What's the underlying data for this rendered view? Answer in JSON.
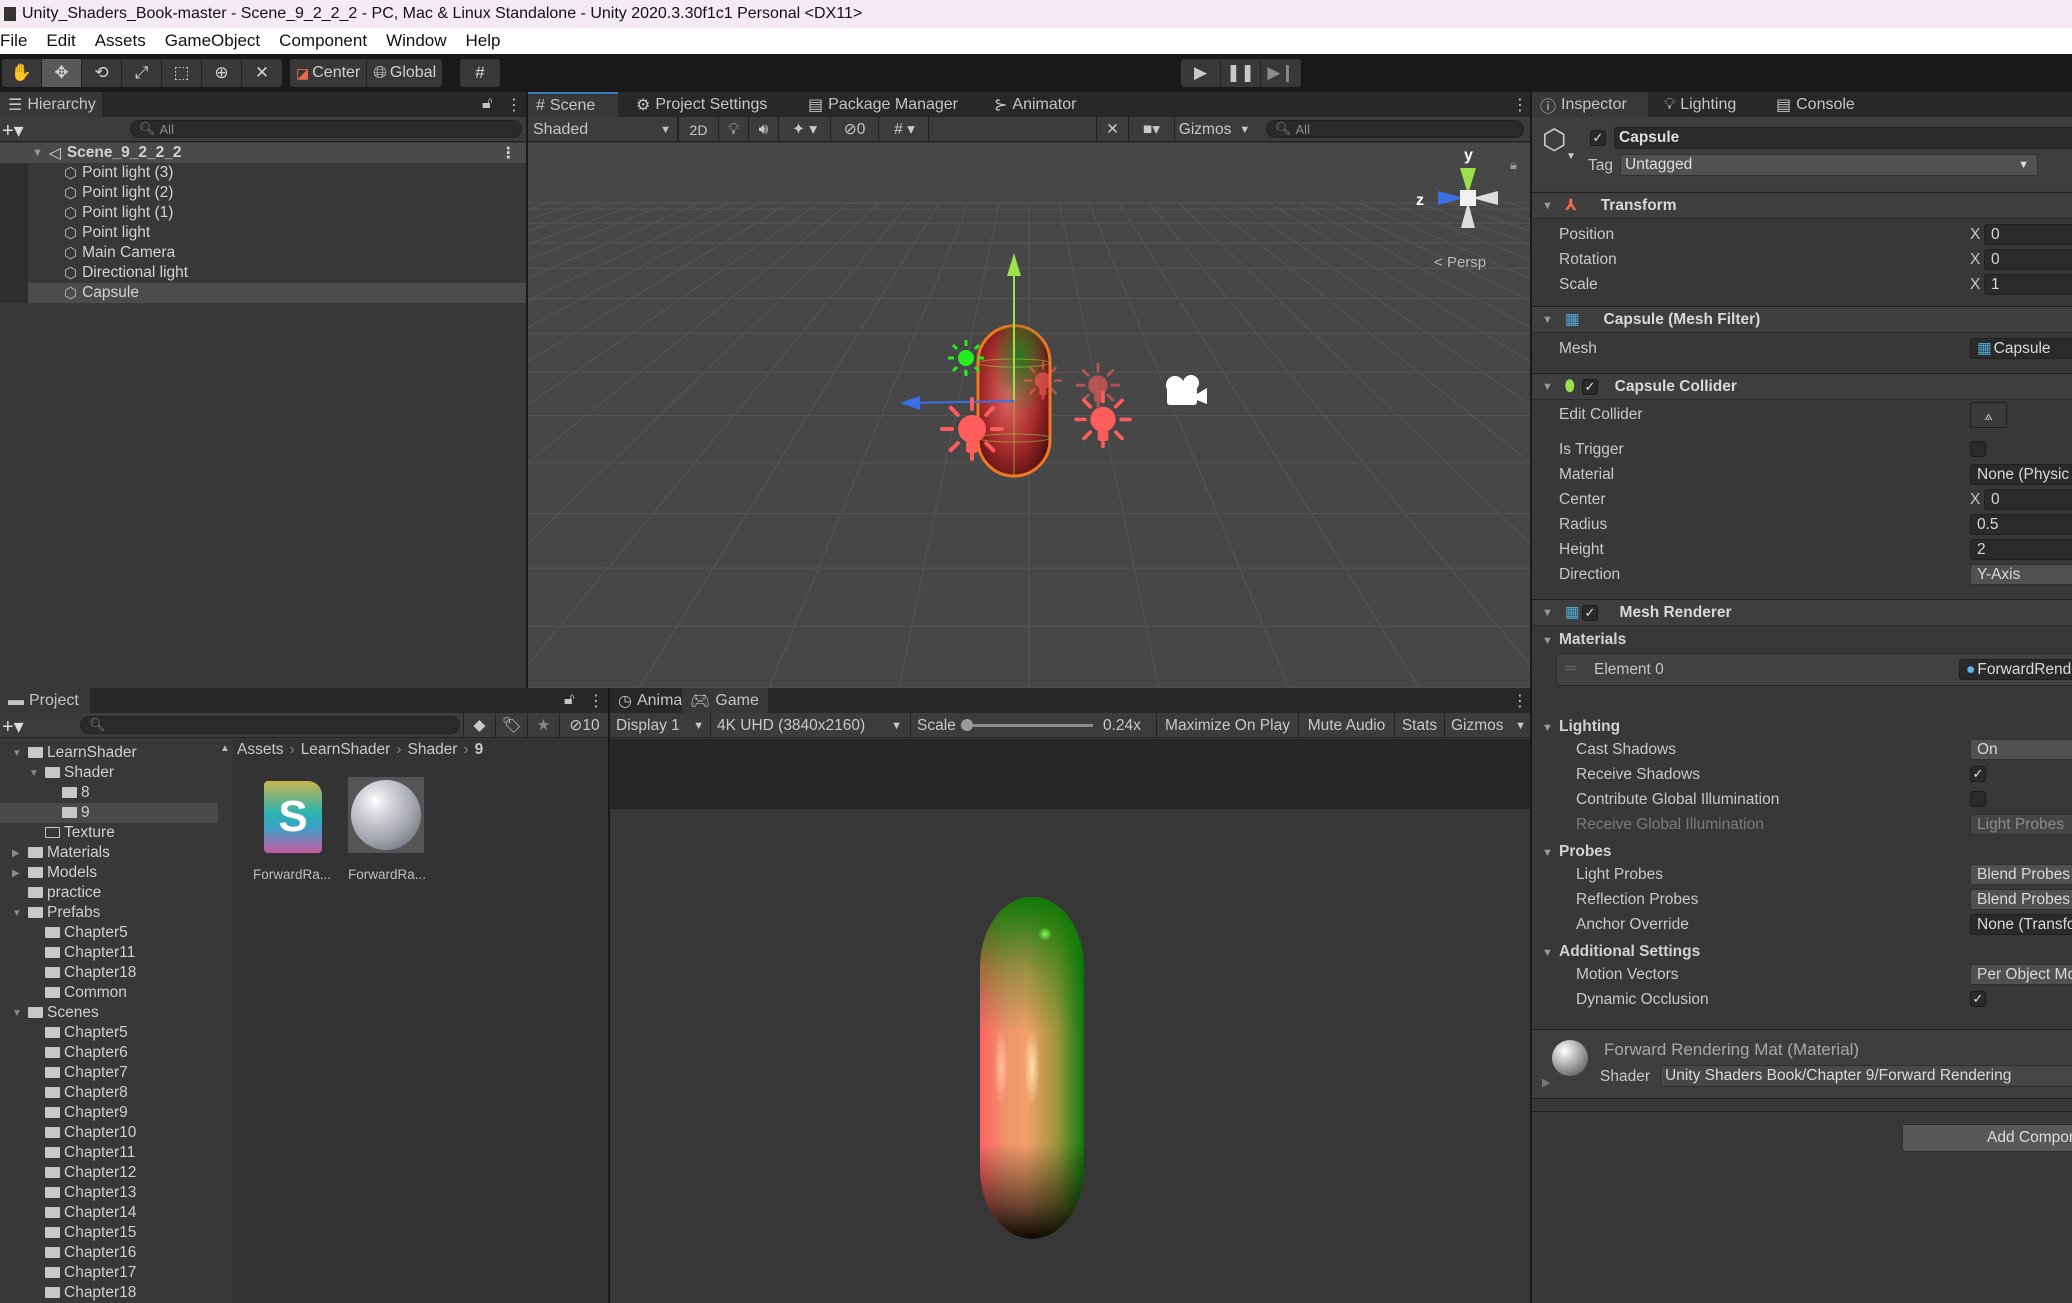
{
  "window": {
    "title": "Unity_Shaders_Book-master - Scene_9_2_2_2 - PC, Mac & Linux Standalone - Unity 2020.3.30f1c1 Personal <DX11>"
  },
  "menu": [
    "File",
    "Edit",
    "Assets",
    "GameObject",
    "Component",
    "Window",
    "Help"
  ],
  "toolbar": {
    "tools": [
      "hand-tool",
      "move-tool",
      "rotate-tool",
      "scale-tool",
      "rect-tool",
      "transform-tool",
      "custom-tool"
    ],
    "active_tool": "move-tool",
    "pivot_label": "Center",
    "space_label": "Global",
    "play_controls": [
      "play",
      "pause",
      "step"
    ]
  },
  "hierarchy": {
    "tab_label": "Hierarchy",
    "search_placeholder": "All",
    "scene_name": "Scene_9_2_2_2",
    "items": [
      {
        "label": "Point light (3)",
        "selected": false
      },
      {
        "label": "Point light (2)",
        "selected": false
      },
      {
        "label": "Point light (1)",
        "selected": false
      },
      {
        "label": "Point light",
        "selected": false
      },
      {
        "label": "Main Camera",
        "selected": false
      },
      {
        "label": "Directional light",
        "selected": false
      },
      {
        "label": "Capsule",
        "selected": true
      }
    ]
  },
  "scene_panel": {
    "tabs": [
      {
        "label": "Scene",
        "icon": "grid-icon",
        "active": true
      },
      {
        "label": "Project Settings",
        "icon": "gear-icon",
        "active": false
      },
      {
        "label": "Package Manager",
        "icon": "package-icon",
        "active": false
      },
      {
        "label": "Animator",
        "icon": "animator-icon",
        "active": false
      }
    ],
    "shading_mode": "Shaded",
    "mode_2d_label": "2D",
    "hidden_count": "0",
    "gizmos_label": "Gizmos",
    "search_placeholder": "All",
    "gizmo": {
      "y_label": "y",
      "z_label": "z",
      "projection": "Persp"
    },
    "colors": {
      "point_light": "#ff5c5c",
      "directional_light": "#22ee22",
      "y_axis": "#9be24a",
      "z_axis": "#3b6fe8",
      "selection_outline": "#f07820"
    }
  },
  "inspector": {
    "tabs": [
      {
        "label": "Inspector",
        "icon": "info-icon",
        "active": true
      },
      {
        "label": "Lighting",
        "icon": "bulb-icon",
        "active": false
      },
      {
        "label": "Console",
        "icon": "console-icon",
        "active": false
      }
    ],
    "object_name": "Capsule",
    "active": true,
    "tag_label": "Tag",
    "tag_value": "Untagged",
    "transform": {
      "title": "Transform",
      "rows": [
        {
          "label": "Position",
          "x_label": "X",
          "x": "0"
        },
        {
          "label": "Rotation",
          "x_label": "X",
          "x": "0"
        },
        {
          "label": "Scale",
          "x_label": "X",
          "x": "1"
        }
      ]
    },
    "mesh_filter": {
      "title": "Capsule (Mesh Filter)",
      "mesh_label": "Mesh",
      "mesh_value": "Capsule"
    },
    "capsule_collider": {
      "title": "Capsule Collider",
      "enabled": true,
      "edit_collider_label": "Edit Collider",
      "is_trigger_label": "Is Trigger",
      "is_trigger": false,
      "material_label": "Material",
      "material_value": "None (Physic Material)",
      "center_label": "Center",
      "center_x_label": "X",
      "center_x": "0",
      "radius_label": "Radius",
      "radius": "0.5",
      "height_label": "Height",
      "height": "2",
      "direction_label": "Direction",
      "direction": "Y-Axis"
    },
    "mesh_renderer": {
      "title": "Mesh Renderer",
      "enabled": true,
      "materials_label": "Materials",
      "element_label": "Element 0",
      "element_value": "ForwardRenderingMat",
      "lighting_label": "Lighting",
      "cast_shadows_label": "Cast Shadows",
      "cast_shadows": "On",
      "receive_shadows_label": "Receive Shadows",
      "receive_shadows": true,
      "contribute_gi_label": "Contribute Global Illumination",
      "contribute_gi": false,
      "receive_gi_label": "Receive Global Illumination",
      "receive_gi": "Light Probes",
      "probes_label": "Probes",
      "light_probes_label": "Light Probes",
      "light_probes": "Blend Probes",
      "reflection_probes_label": "Reflection Probes",
      "reflection_probes": "Blend Probes",
      "anchor_override_label": "Anchor Override",
      "anchor_override": "None (Transform)",
      "additional_label": "Additional Settings",
      "motion_vectors_label": "Motion Vectors",
      "motion_vectors": "Per Object Motion",
      "dynamic_occlusion_label": "Dynamic Occlusion",
      "dynamic_occlusion": true
    },
    "material": {
      "title": "Forward Rendering Mat (Material)",
      "shader_label": "Shader",
      "shader_value": "Unity Shaders Book/Chapter 9/Forward Rendering"
    },
    "add_component_label": "Add Component"
  },
  "project": {
    "tab_label": "Project",
    "hidden_count": "10",
    "breadcrumb": [
      "Assets",
      "LearnShader",
      "Shader",
      "9"
    ],
    "tree": [
      {
        "label": "LearnShader",
        "depth": 0,
        "expanded": true,
        "arrow": true,
        "open": true
      },
      {
        "label": "Shader",
        "depth": 1,
        "expanded": true,
        "arrow": true,
        "open": true
      },
      {
        "label": "8",
        "depth": 2,
        "expanded": false,
        "arrow": false
      },
      {
        "label": "9",
        "depth": 2,
        "expanded": false,
        "arrow": false,
        "selected": true
      },
      {
        "label": "Texture",
        "depth": 1,
        "expanded": false,
        "arrow": false,
        "empty": true
      },
      {
        "label": "Materials",
        "depth": 0,
        "expanded": false,
        "arrow": true
      },
      {
        "label": "Models",
        "depth": 0,
        "expanded": false,
        "arrow": true
      },
      {
        "label": "practice",
        "depth": 0,
        "expanded": false,
        "arrow": false
      },
      {
        "label": "Prefabs",
        "depth": 0,
        "expanded": true,
        "arrow": true,
        "open": true
      },
      {
        "label": "Chapter5",
        "depth": 1
      },
      {
        "label": "Chapter11",
        "depth": 1
      },
      {
        "label": "Chapter18",
        "depth": 1
      },
      {
        "label": "Common",
        "depth": 1
      },
      {
        "label": "Scenes",
        "depth": 0,
        "expanded": true,
        "arrow": true,
        "open": true
      },
      {
        "label": "Chapter5",
        "depth": 1
      },
      {
        "label": "Chapter6",
        "depth": 1
      },
      {
        "label": "Chapter7",
        "depth": 1
      },
      {
        "label": "Chapter8",
        "depth": 1
      },
      {
        "label": "Chapter9",
        "depth": 1
      },
      {
        "label": "Chapter10",
        "depth": 1
      },
      {
        "label": "Chapter11",
        "depth": 1
      },
      {
        "label": "Chapter12",
        "depth": 1
      },
      {
        "label": "Chapter13",
        "depth": 1
      },
      {
        "label": "Chapter14",
        "depth": 1
      },
      {
        "label": "Chapter15",
        "depth": 1
      },
      {
        "label": "Chapter16",
        "depth": 1
      },
      {
        "label": "Chapter17",
        "depth": 1
      },
      {
        "label": "Chapter18",
        "depth": 1
      }
    ],
    "assets": [
      {
        "label": "ForwardRa...",
        "type": "shader"
      },
      {
        "label": "ForwardRa...",
        "type": "material"
      }
    ]
  },
  "game_panel": {
    "tabs": [
      {
        "label": "Animation",
        "icon": "clock-icon",
        "active": false
      },
      {
        "label": "Game",
        "icon": "gamepad-icon",
        "active": true
      }
    ],
    "display": "Display 1",
    "resolution": "4K UHD (3840x2160)",
    "scale_label": "Scale",
    "scale_value": "0.24x",
    "scale_fraction": 0.0,
    "maximize_label": "Maximize On Play",
    "mute_label": "Mute Audio",
    "stats_label": "Stats",
    "gizmos_label": "Gizmos"
  }
}
